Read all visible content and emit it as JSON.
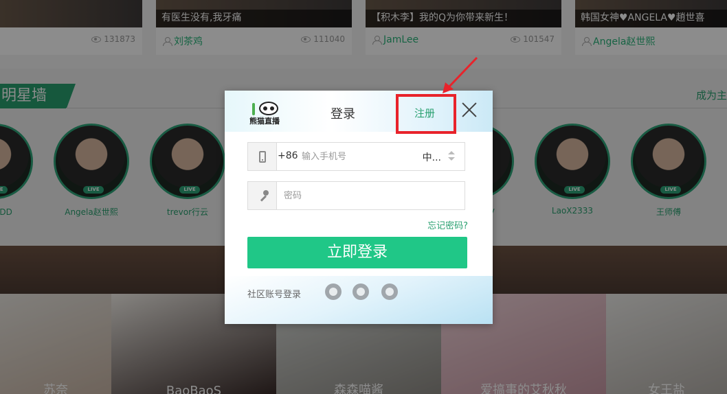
{
  "video_cards": [
    {
      "caption": "",
      "author": "",
      "views": "131873"
    },
    {
      "caption": "有医生没有,我牙痛",
      "author": "刘茶鸡",
      "views": "111040"
    },
    {
      "caption": "【积木李】我的Q为你带来新生！",
      "author": "JamLee",
      "views": "101547"
    },
    {
      "caption": "韩国女神♥ANGELA♥趙世喜",
      "author": "Angela赵世熙",
      "views": ""
    }
  ],
  "star_wall": {
    "title": "明星墙",
    "link": "成为主",
    "live_badge": "LIVE",
    "stars": [
      {
        "name": "线的PDD"
      },
      {
        "name": "Angela赵世熙"
      },
      {
        "name": "trevor行云"
      },
      {
        "name": "y"
      },
      {
        "name": "LaoX2333"
      },
      {
        "name": "王师傅"
      }
    ]
  },
  "bottom_tiles": [
    {
      "name": "苏奈"
    },
    {
      "name": "BaoBaoS"
    },
    {
      "name": "森森喵酱"
    },
    {
      "name": "爱搞事的艾秋秋"
    },
    {
      "name": "女王盐"
    }
  ],
  "modal": {
    "logo_text": "熊猫直播",
    "tab_login": "登录",
    "tab_register": "注册",
    "phone": {
      "country_code": "+86",
      "placeholder": "输入手机号",
      "region": "中..."
    },
    "password": {
      "placeholder": "密码"
    },
    "forgot_password": "忘记密码?",
    "login_button": "立即登录",
    "social_label": "社区账号登录",
    "social_icons": [
      "qq-icon",
      "wechat-icon",
      "weibo-icon"
    ]
  },
  "colors": {
    "brand_green": "#29a070",
    "button_green": "#20c787",
    "highlight_red": "#e8232b"
  }
}
